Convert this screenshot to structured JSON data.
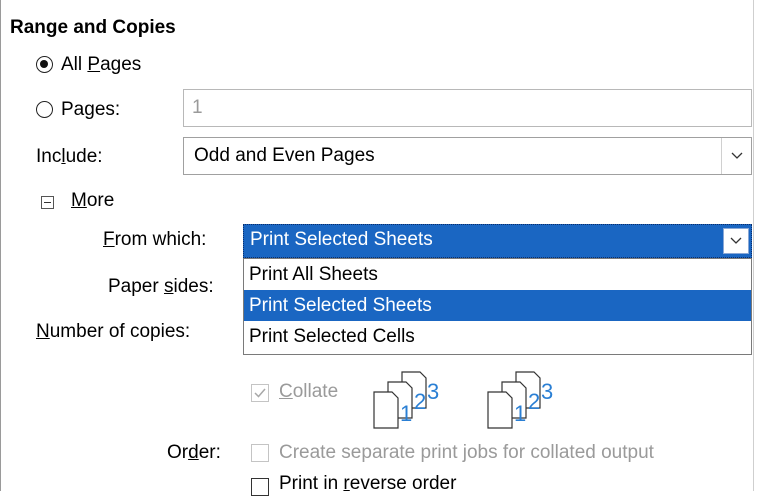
{
  "section_title": "Range and Copies",
  "all_pages": {
    "label_pre": "All ",
    "label_u": "P",
    "label_post": "ages",
    "checked": true
  },
  "pages": {
    "label_pre": "Pa",
    "label_u": "g",
    "label_post": "es:",
    "value": "1",
    "checked": false
  },
  "include": {
    "label_pre": "Inc",
    "label_u": "l",
    "label_post": "ude:",
    "value": "Odd and Even Pages"
  },
  "more": {
    "label_u": "M",
    "label_post": "ore"
  },
  "from_which": {
    "label_u": "F",
    "label_post": "rom which:",
    "value": "Print Selected Sheets",
    "options": [
      "Print All Sheets",
      "Print Selected Sheets",
      "Print Selected Cells"
    ],
    "selected_index": 1
  },
  "paper_sides": {
    "label_pre": "Paper ",
    "label_u": "s",
    "label_post": "ides:"
  },
  "copies": {
    "label_u": "N",
    "label_post": "umber of copies:"
  },
  "collate": {
    "label_u": "C",
    "label_post": "ollate",
    "checked": true,
    "disabled": true
  },
  "collate_icons": [
    "1",
    "2",
    "3"
  ],
  "order": {
    "label_pre": "Or",
    "label_u": "d",
    "label_post": "er:",
    "separate_jobs": "Create separate print jobs for collated output",
    "reverse_pre": "Print in ",
    "reverse_u": "r",
    "reverse_post": "everse order"
  },
  "colors": {
    "highlight": "#1a66c2",
    "icon_blue": "#2a7fd4",
    "disabled": "#9a9a9a"
  }
}
